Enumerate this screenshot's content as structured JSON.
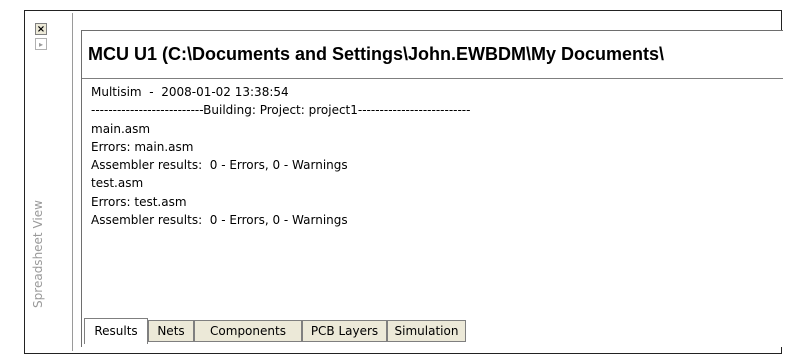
{
  "window": {
    "close_glyph": "×",
    "pin_glyph": "▸",
    "side_title": "Spreadsheet View"
  },
  "panel": {
    "title": "MCU U1 (C:\\Documents and Settings\\John.EWBDM\\My Documents\\"
  },
  "log": {
    "lines": [
      "Multisim  -  2008-01-02 13:38:54",
      "--------------------------Building: Project: project1--------------------------",
      "main.asm",
      "Errors: main.asm",
      "Assembler results:  0 - Errors, 0 - Warnings",
      "test.asm",
      "Errors: test.asm",
      "Assembler results:  0 - Errors, 0 - Warnings"
    ]
  },
  "tabs": [
    {
      "label": "Results",
      "active": true
    },
    {
      "label": "Nets",
      "active": false
    },
    {
      "label": "Components",
      "active": false
    },
    {
      "label": "PCB Layers",
      "active": false
    },
    {
      "label": "Simulation",
      "active": false
    }
  ]
}
